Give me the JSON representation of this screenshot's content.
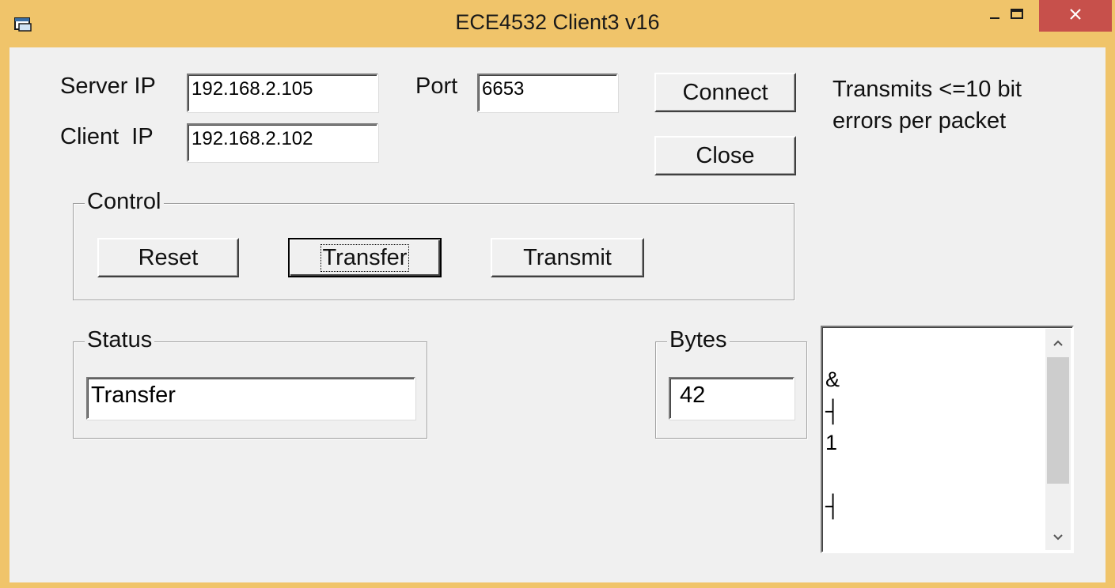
{
  "window": {
    "title": "ECE4532 Client3 v16",
    "colors": {
      "frame": "#f0c46a",
      "close_button": "#c7504b",
      "client_bg": "#f0f0f0"
    }
  },
  "icons": {
    "app": "app-window-icon",
    "minimize": "minimize-icon",
    "maximize": "maximize-icon",
    "close": "close-icon",
    "scroll_up": "chevron-up-icon",
    "scroll_down": "chevron-down-icon"
  },
  "connection": {
    "server_ip_label": "Server IP",
    "server_ip_value": "192.168.2.105",
    "client_ip_label": "Client  IP",
    "client_ip_value": "192.168.2.102",
    "port_label": "Port",
    "port_value": "6653",
    "connect_label": "Connect",
    "close_label": "Close",
    "note": [
      "Transmits <=10 bit",
      "errors per packet"
    ]
  },
  "control": {
    "group_label": "Control",
    "reset_label": "Reset",
    "transfer_label": "Transfer",
    "transmit_label": "Transmit"
  },
  "status": {
    "group_label": "Status",
    "value": "Transfer"
  },
  "bytes": {
    "group_label": "Bytes",
    "value": "42"
  },
  "received_list": {
    "lines": [
      "",
      "&",
      "┤",
      "1",
      "",
      "┤"
    ]
  }
}
